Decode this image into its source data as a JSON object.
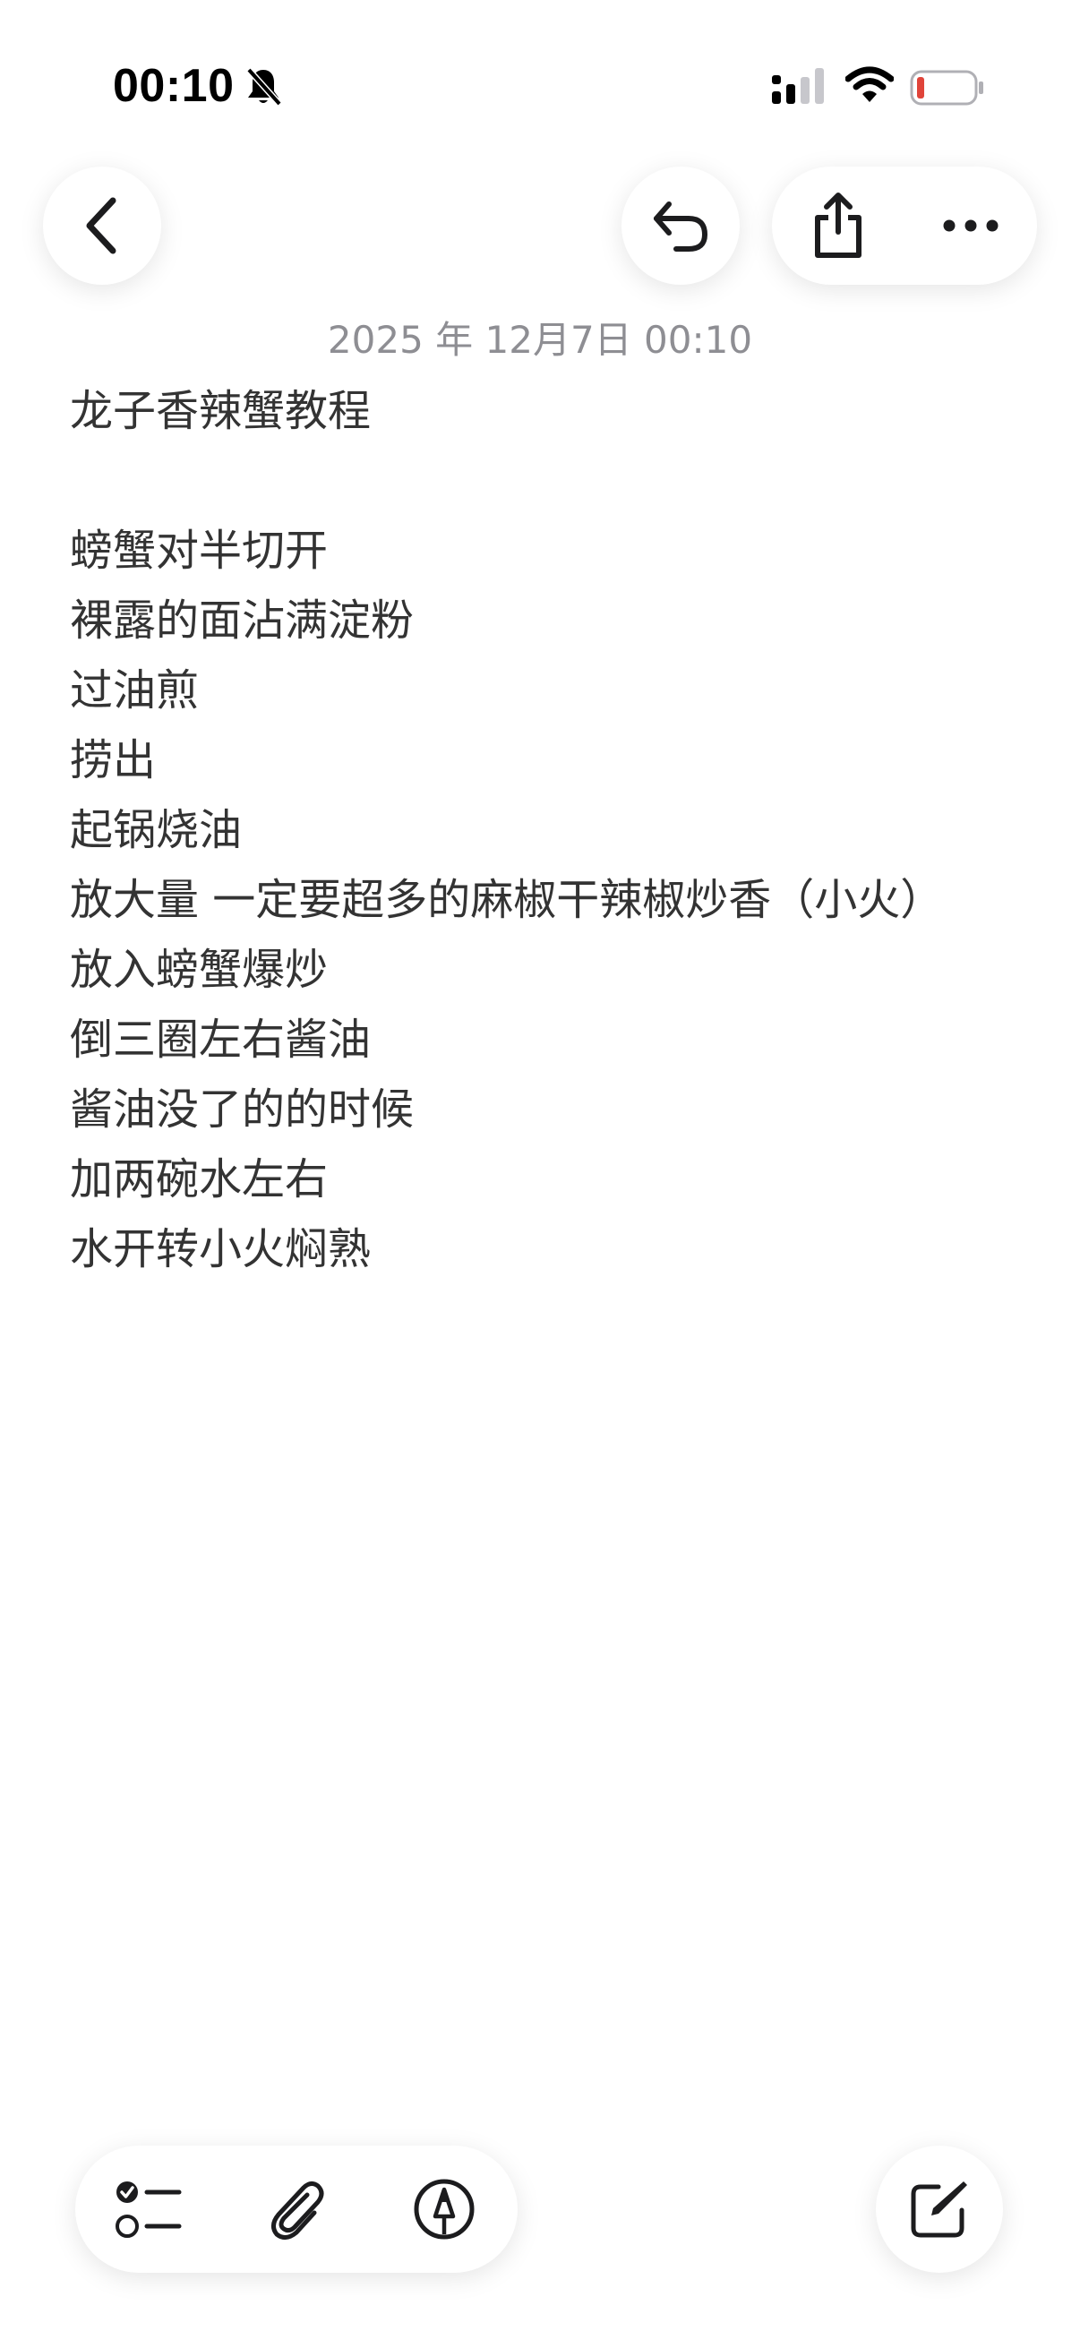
{
  "status_bar": {
    "time": "00:10",
    "icons": [
      "bell-slash-icon",
      "cellular-signal-icon",
      "wifi-icon",
      "battery-low-icon"
    ],
    "battery_color": "#e0443a"
  },
  "top_bar": {
    "back_icon": "chevron-left-icon",
    "undo_icon": "undo-arrow-icon",
    "share_icon": "share-icon",
    "more_icon": "ellipsis-icon"
  },
  "note": {
    "date": "2025 年 12月7日 00:10",
    "title": "龙子香辣蟹教程",
    "lines": [
      "螃蟹对半切开",
      "裸露的面沾满淀粉",
      "过油煎",
      "捞出",
      "起锅烧油",
      "放大量 一定要超多的麻椒干辣椒炒香（小火）",
      "放入螃蟹爆炒",
      "倒三圈左右酱油",
      "酱油没了的的时候",
      "加两碗水左右",
      "水开转小火焖熟"
    ]
  },
  "bottom_toolbar": {
    "icons": [
      "checklist-icon",
      "paperclip-icon",
      "markup-pen-icon",
      "compose-icon"
    ]
  }
}
